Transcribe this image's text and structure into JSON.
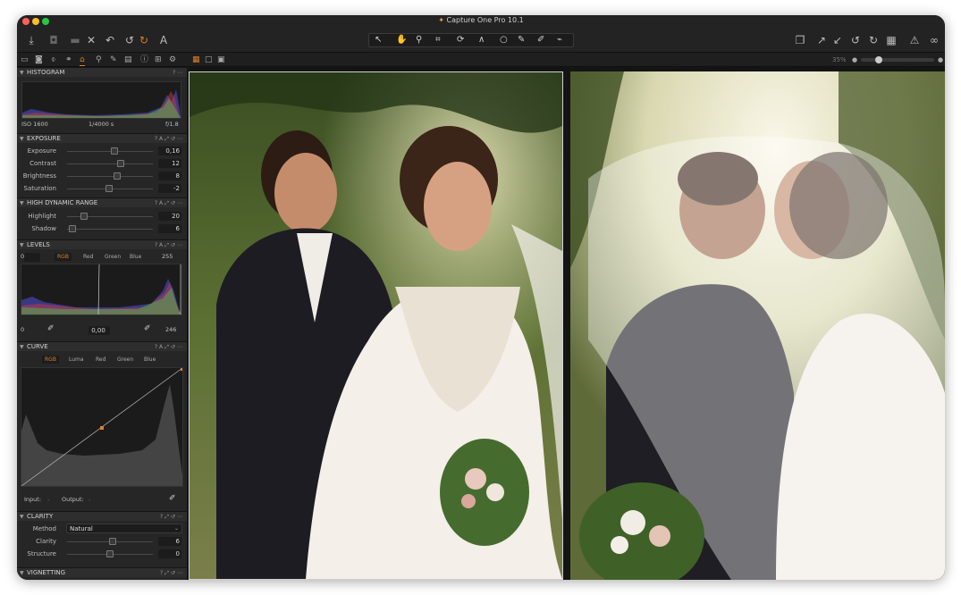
{
  "window": {
    "title": "Capture One Pro 10.1"
  },
  "toolbar": {
    "left_icons": [
      "import-icon",
      "camera-icon",
      "folder-icon",
      "delete-icon",
      "hand-undo-icon",
      "undo-icon",
      "redo-icon",
      "text-icon"
    ],
    "right_icons": [
      "layers-icon",
      "pick-icon",
      "apply-icon",
      "rotate-left-icon",
      "rotate-right-icon",
      "grid-icon",
      "warning-icon",
      "glasses-icon"
    ]
  },
  "subbar": {
    "zoom": "35%"
  },
  "histogram": {
    "title": "HISTOGRAM",
    "iso": "ISO 1600",
    "shutter": "1/4000 s",
    "aperture": "f/1.8"
  },
  "exposure": {
    "title": "EXPOSURE",
    "rows": [
      {
        "label": "Exposure",
        "value": "0,16",
        "pos": 0.55
      },
      {
        "label": "Contrast",
        "value": "12",
        "pos": 0.62
      },
      {
        "label": "Brightness",
        "value": "8",
        "pos": 0.58
      },
      {
        "label": "Saturation",
        "value": "-2",
        "pos": 0.49
      }
    ]
  },
  "hdr": {
    "title": "HIGH DYNAMIC RANGE",
    "rows": [
      {
        "label": "Highlight",
        "value": "20",
        "pos": 0.2
      },
      {
        "label": "Shadow",
        "value": "6",
        "pos": 0.06
      }
    ]
  },
  "levels": {
    "title": "LEVELS",
    "low": "0",
    "high": "255",
    "channels": [
      "RGB",
      "Red",
      "Green",
      "Blue"
    ],
    "out_low": "0",
    "mid": "0,00",
    "out_high": "246"
  },
  "curve": {
    "title": "CURVE",
    "channels": [
      "RGB",
      "Luma",
      "Red",
      "Green",
      "Blue"
    ],
    "input_label": "Input:",
    "input_value": "-",
    "output_label": "Output:",
    "output_value": "-"
  },
  "clarity": {
    "title": "CLARITY",
    "method_label": "Method",
    "method_value": "Natural",
    "rows": [
      {
        "label": "Clarity",
        "value": "6",
        "pos": 0.53
      },
      {
        "label": "Structure",
        "value": "0",
        "pos": 0.5
      }
    ]
  },
  "vignetting": {
    "title": "VIGNETTING"
  },
  "colors": {
    "accent": "#e0802a",
    "panel": "#262626",
    "viewer": "#141414"
  }
}
